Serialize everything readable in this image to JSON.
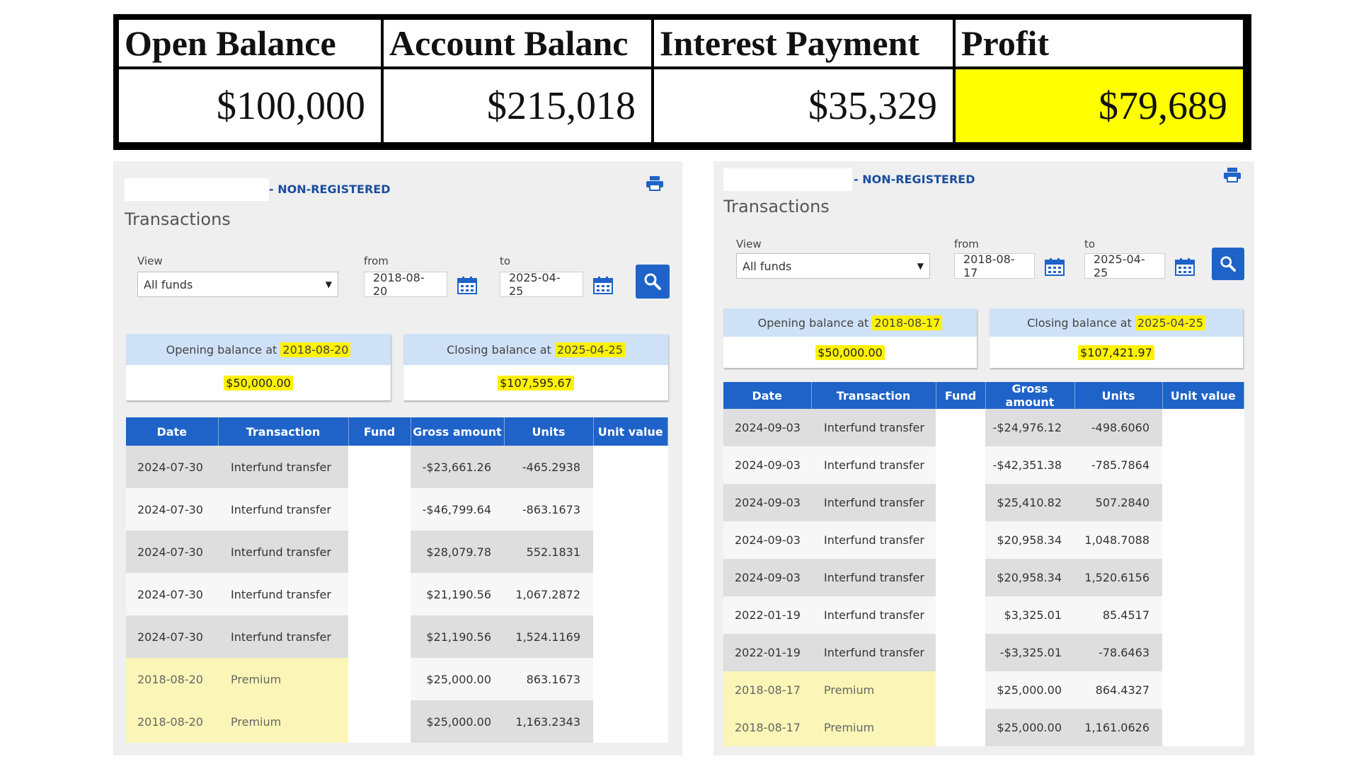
{
  "summary": {
    "headers": [
      "Open Balance",
      "Account Balanc",
      "Interest Payment",
      "Profit"
    ],
    "values": [
      "$100,000",
      "$215,018",
      "$35,329",
      "$79,689"
    ],
    "highlight_color": "#ffff00"
  },
  "panels": [
    {
      "account_suffix": "- NON-REGISTERED",
      "title": "Transactions",
      "view_label": "View",
      "view_value": "All funds",
      "from_label": "from",
      "from_value": "2018-08-20",
      "to_label": "to",
      "to_value": "2025-04-25",
      "opening_text": "Opening balance at",
      "opening_date": "2018-08-20",
      "opening_value": "$50,000.00",
      "closing_text": "Closing balance at",
      "closing_date": "2025-04-25",
      "closing_value": "$107,595.67",
      "columns": [
        "Date",
        "Transaction",
        "Fund",
        "Gross amount",
        "Units",
        "Unit value"
      ],
      "rows": [
        {
          "date": "2024-07-30",
          "transaction": "Interfund transfer",
          "fund": "",
          "gross": "-$23,661.26",
          "units": "-465.2938",
          "unit_value": ""
        },
        {
          "date": "2024-07-30",
          "transaction": "Interfund transfer",
          "fund": "",
          "gross": "-$46,799.64",
          "units": "-863.1673",
          "unit_value": ""
        },
        {
          "date": "2024-07-30",
          "transaction": "Interfund transfer",
          "fund": "",
          "gross": "$28,079.78",
          "units": "552.1831",
          "unit_value": ""
        },
        {
          "date": "2024-07-30",
          "transaction": "Interfund transfer",
          "fund": "",
          "gross": "$21,190.56",
          "units": "1,067.2872",
          "unit_value": ""
        },
        {
          "date": "2024-07-30",
          "transaction": "Interfund transfer",
          "fund": "",
          "gross": "$21,190.56",
          "units": "1,524.1169",
          "unit_value": ""
        },
        {
          "date": "2018-08-20",
          "transaction": "Premium",
          "fund": "",
          "gross": "$25,000.00",
          "units": "863.1673",
          "unit_value": ""
        },
        {
          "date": "2018-08-20",
          "transaction": "Premium",
          "fund": "",
          "gross": "$25,000.00",
          "units": "1,163.2343",
          "unit_value": ""
        }
      ]
    },
    {
      "account_suffix": "- NON-REGISTERED",
      "title": "Transactions",
      "view_label": "View",
      "view_value": "All funds",
      "from_label": "from",
      "from_value": "2018-08-17",
      "to_label": "to",
      "to_value": "2025-04-25",
      "opening_text": "Opening balance at",
      "opening_date": "2018-08-17",
      "opening_value": "$50,000.00",
      "closing_text": "Closing balance at",
      "closing_date": "2025-04-25",
      "closing_value": "$107,421.97",
      "columns": [
        "Date",
        "Transaction",
        "Fund",
        "Gross amount",
        "Units",
        "Unit value"
      ],
      "rows": [
        {
          "date": "2024-09-03",
          "transaction": "Interfund transfer",
          "fund": "",
          "gross": "-$24,976.12",
          "units": "-498.6060",
          "unit_value": ""
        },
        {
          "date": "2024-09-03",
          "transaction": "Interfund transfer",
          "fund": "",
          "gross": "-$42,351.38",
          "units": "-785.7864",
          "unit_value": ""
        },
        {
          "date": "2024-09-03",
          "transaction": "Interfund transfer",
          "fund": "",
          "gross": "$25,410.82",
          "units": "507.2840",
          "unit_value": ""
        },
        {
          "date": "2024-09-03",
          "transaction": "Interfund transfer",
          "fund": "",
          "gross": "$20,958.34",
          "units": "1,048.7088",
          "unit_value": ""
        },
        {
          "date": "2024-09-03",
          "transaction": "Interfund transfer",
          "fund": "",
          "gross": "$20,958.34",
          "units": "1,520.6156",
          "unit_value": ""
        },
        {
          "date": "2022-01-19",
          "transaction": "Interfund transfer",
          "fund": "",
          "gross": "$3,325.01",
          "units": "85.4517",
          "unit_value": ""
        },
        {
          "date": "2022-01-19",
          "transaction": "Interfund transfer",
          "fund": "",
          "gross": "-$3,325.01",
          "units": "-78.6463",
          "unit_value": ""
        },
        {
          "date": "2018-08-17",
          "transaction": "Premium",
          "fund": "",
          "gross": "$25,000.00",
          "units": "864.4327",
          "unit_value": ""
        },
        {
          "date": "2018-08-17",
          "transaction": "Premium",
          "fund": "",
          "gross": "$25,000.00",
          "units": "1,161.0626",
          "unit_value": ""
        }
      ]
    }
  ],
  "colors": {
    "accent_blue": "#1f63c9",
    "balance_header_bg": "#cfe1f7",
    "highlight_yellow": "#fff200",
    "premium_row_bg": "#fbf6b7",
    "panel_bg": "#efefef"
  },
  "icons": [
    "print-icon",
    "calendar-icon",
    "search-icon",
    "chevron-down-icon"
  ]
}
